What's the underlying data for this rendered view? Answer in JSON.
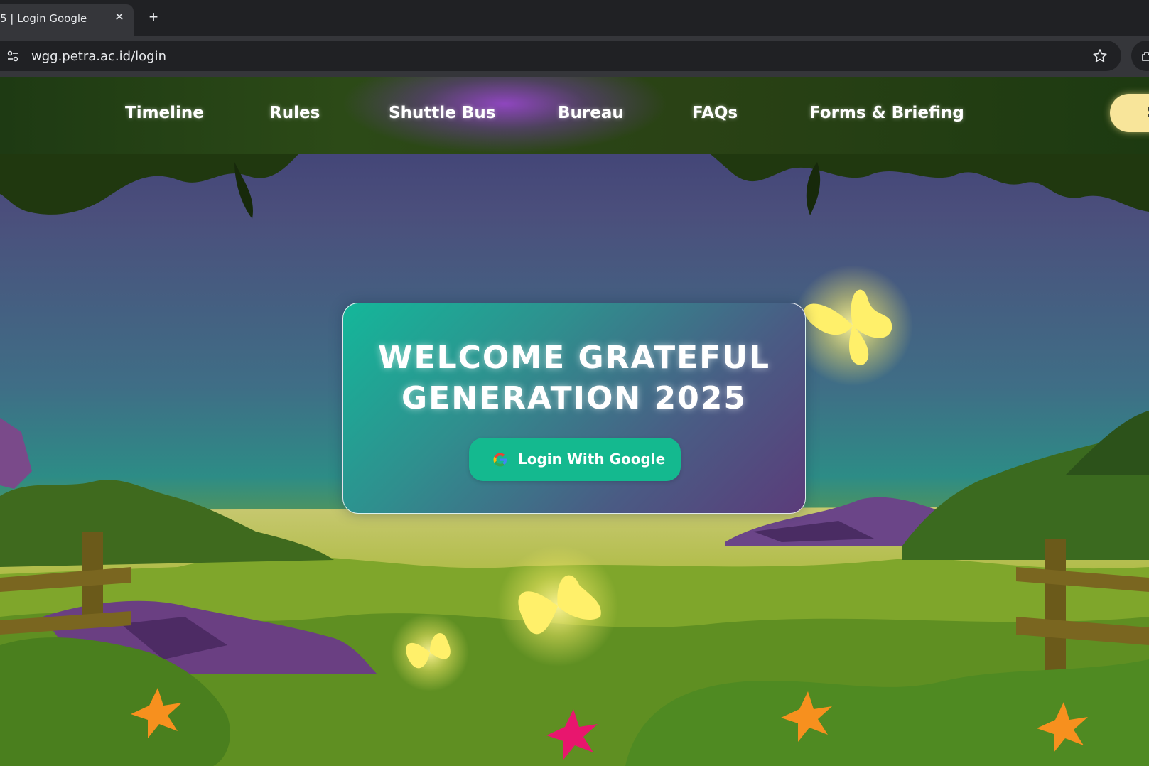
{
  "browser": {
    "tab_title": "5 | Login Google",
    "tab_close_glyph": "✕",
    "new_tab_glyph": "+",
    "url": "wgg.petra.ac.id/login"
  },
  "nav": {
    "items": [
      "Timeline",
      "Rules",
      "Shuttle Bus",
      "Bureau",
      "FAQs",
      "Forms & Briefing"
    ],
    "pill_label": "S"
  },
  "card": {
    "title_line1": "WELCOME GRATEFUL",
    "title_line2": "GENERATION 2025",
    "button_label": "Login With Google"
  },
  "colors": {
    "accent": "#14b98f",
    "pill": "#f8e59a",
    "butterfly": "#fff06a"
  },
  "icons": [
    "site-info-icon",
    "star-icon",
    "extension-icon",
    "google-icon",
    "butterfly-icon",
    "flower-icon"
  ]
}
